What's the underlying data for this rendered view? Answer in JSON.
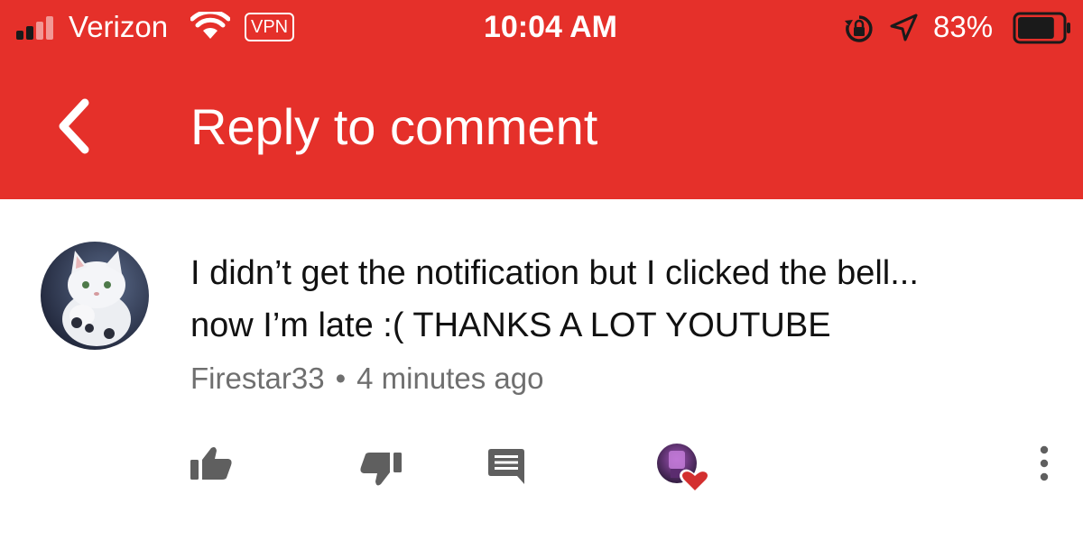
{
  "status_bar": {
    "carrier": "Verizon",
    "vpn_label": "VPN",
    "time": "10:04 AM",
    "battery_percent": "83%",
    "battery_level": 0.83,
    "icons": [
      "signal-icon",
      "wifi-icon",
      "lock-rotation-icon",
      "location-icon",
      "battery-icon"
    ]
  },
  "header": {
    "title": "Reply to comment",
    "back_icon": "back-chevron-icon",
    "color": "#e5302a"
  },
  "comment": {
    "text_line1": "I didn’t get the notification but I clicked the bell...",
    "text_line2": "now I’m late :( THANKS A LOT YOUTUBE",
    "author": "Firestar33",
    "separator": "•",
    "time_ago": "4 minutes ago",
    "avatar_icon": "white-cat-avatar"
  },
  "actions": {
    "icons": [
      "thumbs-up-icon",
      "thumbs-down-icon",
      "reply-icon",
      "creator-heart-icon",
      "more-vertical-icon"
    ]
  }
}
